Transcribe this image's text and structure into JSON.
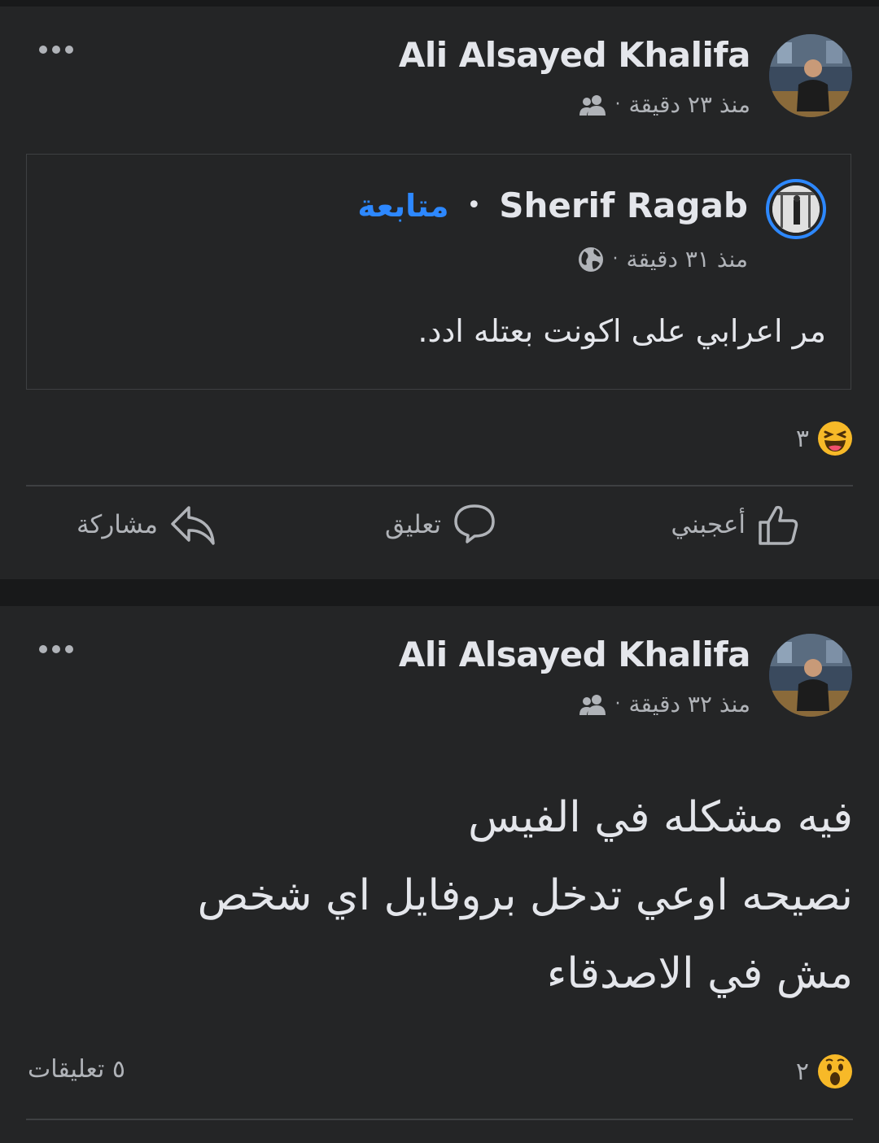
{
  "post1": {
    "author": "Ali Alsayed Khalifa",
    "time": "منذ ٢٣ دقيقة",
    "dot": "·",
    "audience_icon": "friends-icon",
    "shared": {
      "author": "Sherif Ragab",
      "separator": "•",
      "follow_label": "متابعة",
      "time": "منذ ٣١ دقيقة",
      "dot": "·",
      "audience_icon": "globe-icon",
      "text": "مر اعرابي على اكونت بعتله ادد."
    },
    "reaction": {
      "icon": "haha-emoji-icon",
      "count": "٣"
    },
    "actions": {
      "like": "أعجبني",
      "comment": "تعليق",
      "share": "مشاركة"
    }
  },
  "post2": {
    "author": "Ali Alsayed Khalifa",
    "time": "منذ ٣٢ دقيقة",
    "dot": "·",
    "audience_icon": "friends-icon",
    "text_lines": [
      "فيه مشكله في الفيس",
      "نصيحه اوعي تدخل بروفايل اي شخص",
      "مش في الاصدقاء"
    ],
    "reaction": {
      "icon": "wow-emoji-icon",
      "count": "٢"
    },
    "comments": "٥ تعليقات"
  },
  "colors": {
    "background": "#18191a",
    "card": "#242526",
    "text": "#e4e6eb",
    "secondary": "#b0b3b8",
    "accent": "#2d88ff",
    "divider": "#3e4042"
  }
}
